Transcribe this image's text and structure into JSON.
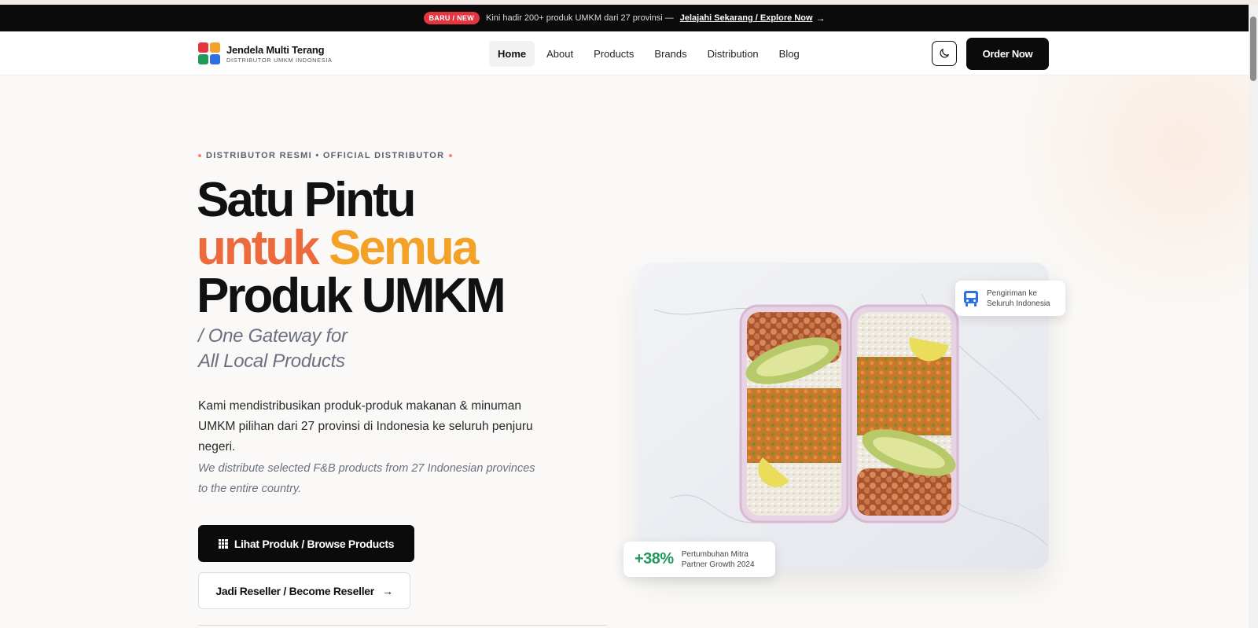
{
  "announcement": {
    "badge": "BARU / NEW",
    "text": "Kini hadir 200+ produk UMKM dari 27 provinsi —",
    "link": "Jelajahi Sekarang / Explore Now",
    "arrow": "→"
  },
  "brand": {
    "name": "Jendela Multi Terang",
    "tagline": "DISTRIBUTOR UMKM INDONESIA",
    "colors": [
      "#e5353e",
      "#f4a227",
      "#22995a",
      "#2f6fe0"
    ]
  },
  "nav": {
    "items": [
      {
        "label": "Home",
        "active": true
      },
      {
        "label": "About"
      },
      {
        "label": "Products"
      },
      {
        "label": "Brands"
      },
      {
        "label": "Distribution"
      },
      {
        "label": "Blog"
      }
    ],
    "theme_icon": "moon-icon",
    "order_label": "Order Now"
  },
  "hero": {
    "eyebrow": "DISTRIBUTOR RESMI • OFFICIAL DISTRIBUTOR",
    "title_line1": "Satu Pintu",
    "title_line2a": "untuk",
    "title_line2b": "Semua",
    "title_line3": "Produk UMKM",
    "subtitle_line1": "/ One Gateway for",
    "subtitle_line2": "All Local Products",
    "description": "Kami mendistribusikan produk-produk makanan & minuman UMKM pilihan dari 27 provinsi di Indonesia ke seluruh penjuru negeri.",
    "description_en": "We distribute selected F&B products from 27 Indonesian provinces to the entire country.",
    "primary_cta": "Lihat Produk / Browse Products",
    "secondary_cta": "Jadi Reseller / Become Reseller",
    "secondary_arrow": "→"
  },
  "cards": {
    "shipping_line1": "Pengiriman ke",
    "shipping_line2": "Seluruh Indonesia",
    "growth_value": "+38%",
    "growth_line1": "Pertumbuhan Mitra",
    "growth_line2": "Partner Growth 2024"
  },
  "accent_colors": {
    "orange": "#ec6a3b",
    "amber": "#f4a227",
    "green": "#22995a",
    "blue": "#2f6fe0",
    "red": "#e5353e"
  }
}
